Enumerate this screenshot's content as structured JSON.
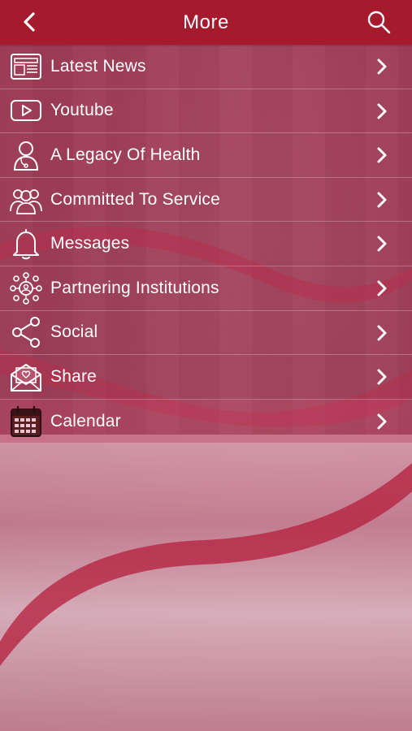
{
  "header": {
    "title": "More"
  },
  "menu": {
    "items": [
      {
        "label": "Latest News",
        "icon": "newspaper-icon"
      },
      {
        "label": "Youtube",
        "icon": "youtube-play-icon"
      },
      {
        "label": "A Legacy Of Health",
        "icon": "doctor-icon"
      },
      {
        "label": "Committed To Service",
        "icon": "group-icon"
      },
      {
        "label": "Messages",
        "icon": "bell-icon"
      },
      {
        "label": "Partnering Institutions",
        "icon": "network-people-icon"
      },
      {
        "label": "Social",
        "icon": "share-nodes-icon"
      },
      {
        "label": "Share",
        "icon": "envelope-heart-icon"
      },
      {
        "label": "Calendar",
        "icon": "calendar-icon"
      }
    ]
  },
  "colors": {
    "header": "#a51b2d",
    "accent": "#c0283f"
  }
}
